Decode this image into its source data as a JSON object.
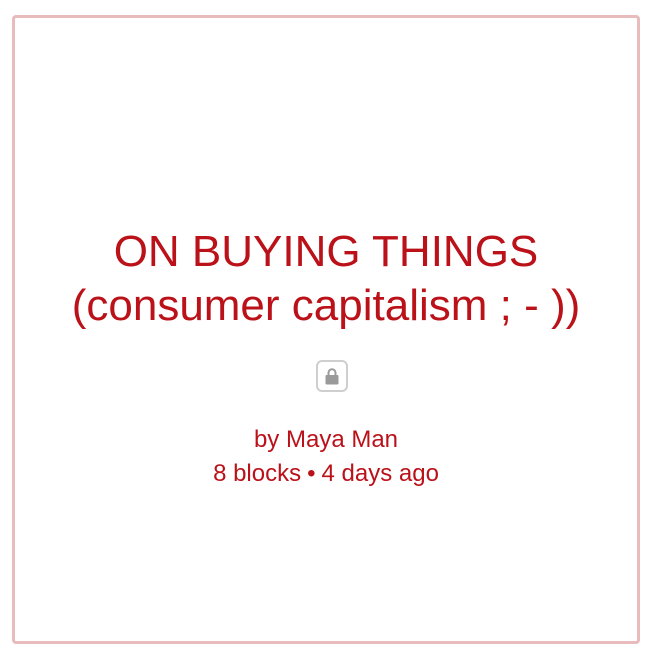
{
  "channel": {
    "title_line1": "ON BUYING THINGS",
    "title_line2": "(consumer capitalism ; - ))",
    "author_prefix": "by",
    "author_name": "Maya Man",
    "block_count": "8 blocks",
    "separator": "•",
    "updated": "4 days ago",
    "visibility_icon": "lock-icon"
  },
  "colors": {
    "text": "#bb1119",
    "border": "#e8bcbc",
    "icon": "#9a9a9a"
  }
}
